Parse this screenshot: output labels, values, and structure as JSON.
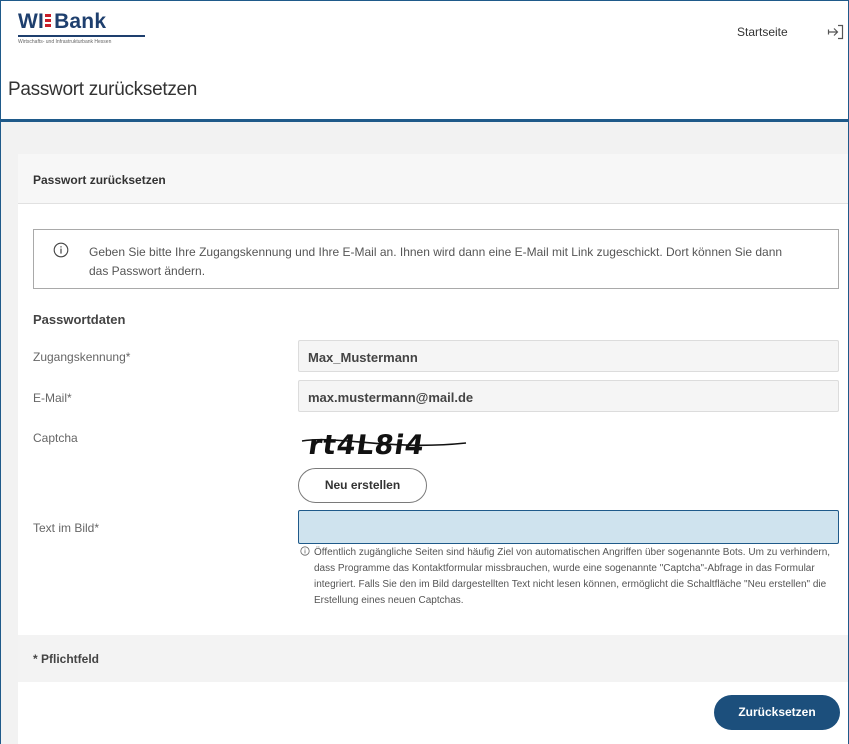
{
  "header": {
    "logo": {
      "brand_left": "WI",
      "brand_right": "Bank",
      "subtitle": "Wirtschafts- und Infrastrukturbank Hessen"
    },
    "nav_link": "Startseite",
    "logout_icon": "logout-icon"
  },
  "page_title": "Passwort zurücksetzen",
  "card": {
    "title": "Passwort zurücksetzen",
    "info_icon": "info-circle-icon",
    "info_text": "Geben Sie bitte Ihre Zugangskennung und Ihre E-Mail an. Ihnen wird dann eine E-Mail mit Link zugeschickt. Dort können Sie dann das Passwort ändern.",
    "section_title": "Passwortdaten",
    "fields": {
      "username_label": "Zugangskennung*",
      "username_value": "Max_Mustermann",
      "email_label": "E-Mail*",
      "email_value": "max.mustermann@mail.de",
      "captcha_label": "Captcha",
      "captcha_text": "rt4L8i4",
      "new_captcha_button": "Neu erstellen",
      "captcha_input_label": "Text im Bild*",
      "captcha_input_value": ""
    },
    "hint_icon": "info-circle-icon",
    "hint_text": "Öffentlich zugängliche Seiten sind häufig Ziel von automatischen Angriffen über sogenannte Bots. Um zu verhindern, dass Programme das Kontaktformular missbrauchen, wurde eine sogenannte \"Captcha\"-Abfrage in das Formular integriert. Falls Sie den im Bild dargestellten Text nicht lesen können, ermöglicht die Schaltfläche \"Neu erstellen\" die Erstellung eines neuen Captchas.",
    "required_note": "* Pflichtfeld",
    "submit_button": "Zurücksetzen"
  },
  "colors": {
    "brand_blue": "#1e3f6e",
    "accent_blue": "#1f5a8a",
    "button_blue": "#1c4f7c",
    "input_focus_bg": "#cfe3ee",
    "logo_red": "#c81e2a"
  }
}
